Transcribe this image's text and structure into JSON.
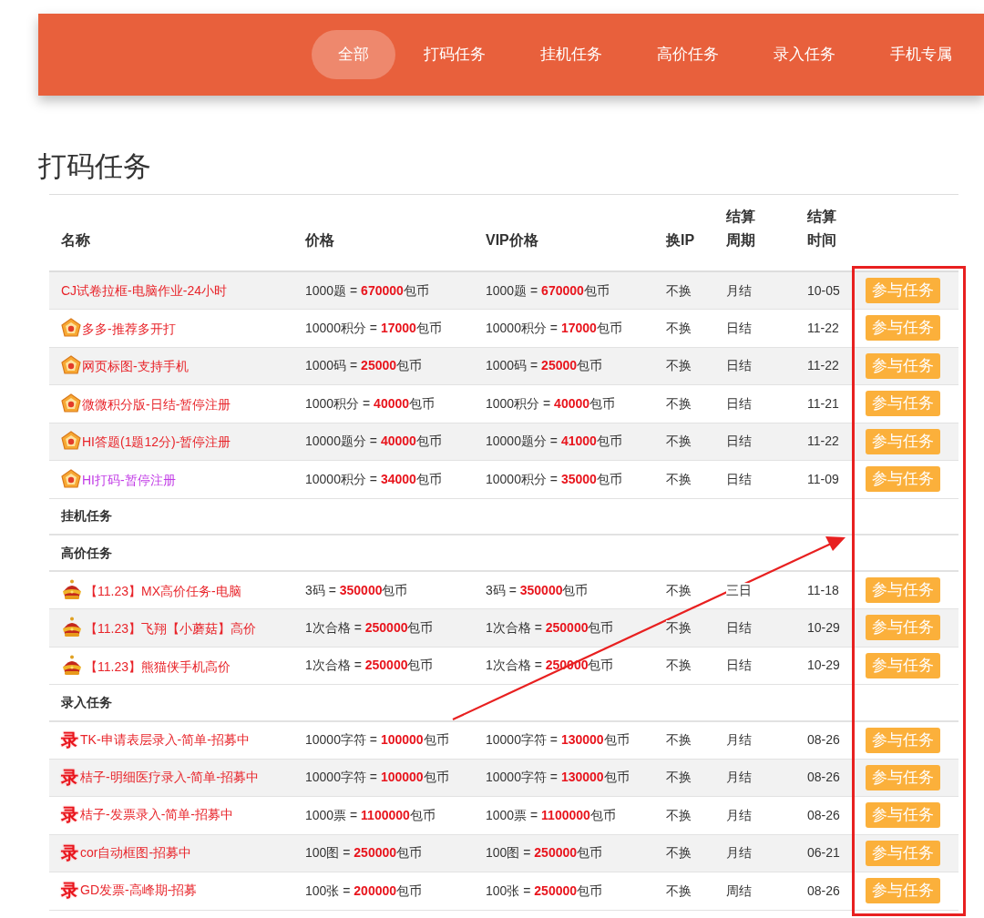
{
  "nav": {
    "tabs": [
      {
        "label": "全部",
        "selected": true
      },
      {
        "label": "打码任务",
        "selected": false
      },
      {
        "label": "挂机任务",
        "selected": false
      },
      {
        "label": "高价任务",
        "selected": false
      },
      {
        "label": "录入任务",
        "selected": false
      },
      {
        "label": "手机专属",
        "selected": false
      }
    ]
  },
  "section_title": "打码任务",
  "table": {
    "columns": [
      "名称",
      "价格",
      "VIP价格",
      "换IP",
      "结算周期",
      "结算时间",
      ""
    ],
    "rows": [
      {
        "kind": "plain",
        "shaded": true,
        "name": "CJ试卷拉框-电脑作业-24小时",
        "color": "#e8242a",
        "price": {
          "pre": "1000题 = ",
          "amount": "670000",
          "unit": "包币"
        },
        "vip_price": {
          "pre": "1000题 = ",
          "amount": "670000",
          "unit": "包币"
        },
        "change_ip": "不换",
        "cycle": "月结",
        "time": "10-05",
        "action": "参与任务"
      },
      {
        "kind": "medal",
        "shaded": false,
        "name": "多多-推荐多开打",
        "color": "#e8242a",
        "price": {
          "pre": "10000积分 = ",
          "amount": "17000",
          "unit": "包币"
        },
        "vip_price": {
          "pre": "10000积分 = ",
          "amount": "17000",
          "unit": "包币"
        },
        "change_ip": "不换",
        "cycle": "日结",
        "time": "11-22",
        "action": "参与任务"
      },
      {
        "kind": "medal",
        "shaded": true,
        "name": "网页标图-支持手机",
        "color": "#e8242a",
        "price": {
          "pre": "1000码 = ",
          "amount": "25000",
          "unit": "包币"
        },
        "vip_price": {
          "pre": "1000码 = ",
          "amount": "25000",
          "unit": "包币"
        },
        "change_ip": "不换",
        "cycle": "日结",
        "time": "11-22",
        "action": "参与任务"
      },
      {
        "kind": "medal",
        "shaded": false,
        "name": "微微积分版-日结-暂停注册",
        "color": "#e8242a",
        "price": {
          "pre": "1000积分 = ",
          "amount": "40000",
          "unit": "包币"
        },
        "vip_price": {
          "pre": "1000积分 = ",
          "amount": "40000",
          "unit": "包币"
        },
        "change_ip": "不换",
        "cycle": "日结",
        "time": "11-21",
        "action": "参与任务"
      },
      {
        "kind": "medal",
        "shaded": true,
        "name": "HI答题(1题12分)-暂停注册",
        "color": "#e8242a",
        "price": {
          "pre": "10000题分 = ",
          "amount": "40000",
          "unit": "包币"
        },
        "vip_price": {
          "pre": "10000题分 = ",
          "amount": "41000",
          "unit": "包币"
        },
        "change_ip": "不换",
        "cycle": "日结",
        "time": "11-22",
        "action": "参与任务"
      },
      {
        "kind": "medal",
        "shaded": false,
        "name": "HI打码-暂停注册",
        "color": "#c13be6",
        "price": {
          "pre": "10000积分 = ",
          "amount": "34000",
          "unit": "包币"
        },
        "vip_price": {
          "pre": "10000积分 = ",
          "amount": "35000",
          "unit": "包币"
        },
        "change_ip": "不换",
        "cycle": "日结",
        "time": "11-09",
        "action": "参与任务"
      },
      {
        "kind": "group",
        "label": "挂机任务"
      },
      {
        "kind": "group",
        "label": "高价任务"
      },
      {
        "kind": "crown",
        "shaded": false,
        "name": "【11.23】MX高价任务-电脑",
        "color": "#e8242a",
        "price": {
          "pre": "3码 = ",
          "amount": "350000",
          "unit": "包币"
        },
        "vip_price": {
          "pre": "3码 = ",
          "amount": "350000",
          "unit": "包币"
        },
        "change_ip": "不换",
        "cycle": "三日",
        "time": "11-18",
        "action": "参与任务"
      },
      {
        "kind": "crown",
        "shaded": true,
        "name": "【11.23】飞翔【小蘑菇】高价",
        "color": "#e8242a",
        "price": {
          "pre": "1次合格 = ",
          "amount": "250000",
          "unit": "包币"
        },
        "vip_price": {
          "pre": "1次合格 = ",
          "amount": "250000",
          "unit": "包币"
        },
        "change_ip": "不换",
        "cycle": "日结",
        "time": "10-29",
        "action": "参与任务"
      },
      {
        "kind": "crown",
        "shaded": false,
        "name": "【11.23】熊猫侠手机高价",
        "color": "#e8242a",
        "price": {
          "pre": "1次合格 = ",
          "amount": "250000",
          "unit": "包币"
        },
        "vip_price": {
          "pre": "1次合格 = ",
          "amount": "250000",
          "unit": "包币"
        },
        "change_ip": "不换",
        "cycle": "日结",
        "time": "10-29",
        "action": "参与任务"
      },
      {
        "kind": "group",
        "label": "录入任务"
      },
      {
        "kind": "record",
        "glyph": "录",
        "shaded": false,
        "name": "TK-申请表层录入-简单-招募中",
        "color": "#e8242a",
        "price": {
          "pre": "10000字符 = ",
          "amount": "100000",
          "unit": "包币"
        },
        "vip_price": {
          "pre": "10000字符 = ",
          "amount": "130000",
          "unit": "包币"
        },
        "change_ip": "不换",
        "cycle": "月结",
        "time": "08-26",
        "action": "参与任务"
      },
      {
        "kind": "record",
        "glyph": "录",
        "shaded": true,
        "name": "桔子-明细医疗录入-简单-招募中",
        "color": "#e8242a",
        "price": {
          "pre": "10000字符 = ",
          "amount": "100000",
          "unit": "包币"
        },
        "vip_price": {
          "pre": "10000字符 = ",
          "amount": "130000",
          "unit": "包币"
        },
        "change_ip": "不换",
        "cycle": "月结",
        "time": "08-26",
        "action": "参与任务"
      },
      {
        "kind": "record",
        "glyph": "录",
        "shaded": false,
        "name": "桔子-发票录入-简单-招募中",
        "color": "#e8242a",
        "price": {
          "pre": "1000票 = ",
          "amount": "1100000",
          "unit": "包币"
        },
        "vip_price": {
          "pre": "1000票 = ",
          "amount": "1100000",
          "unit": "包币"
        },
        "change_ip": "不换",
        "cycle": "月结",
        "time": "08-26",
        "action": "参与任务"
      },
      {
        "kind": "record",
        "glyph": "录",
        "shaded": true,
        "name": "cor自动框图-招募中",
        "color": "#e8242a",
        "price": {
          "pre": "100图 = ",
          "amount": "250000",
          "unit": "包币"
        },
        "vip_price": {
          "pre": "100图 = ",
          "amount": "250000",
          "unit": "包币"
        },
        "change_ip": "不换",
        "cycle": "月结",
        "time": "06-21",
        "action": "参与任务"
      },
      {
        "kind": "record",
        "glyph": "录",
        "shaded": false,
        "name": "GD发票-高峰期-招募",
        "color": "#e8242a",
        "price": {
          "pre": "100张 = ",
          "amount": "200000",
          "unit": "包币"
        },
        "vip_price": {
          "pre": "100张 = ",
          "amount": "250000",
          "unit": "包币"
        },
        "change_ip": "不换",
        "cycle": "周结",
        "time": "08-26",
        "action": "参与任务"
      }
    ]
  }
}
